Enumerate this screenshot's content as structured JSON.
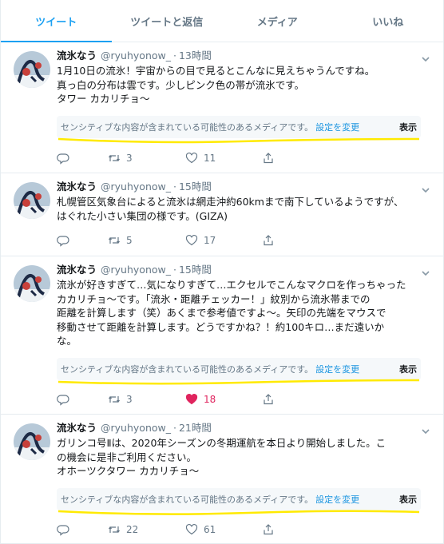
{
  "tabs": [
    {
      "label": "ツイート",
      "active": true
    },
    {
      "label": "ツイートと返信",
      "active": false
    },
    {
      "label": "メディア",
      "active": false
    },
    {
      "label": "いいね",
      "active": false
    }
  ],
  "sensitive_warning": {
    "text": "センシティブな内容が含まれている可能性のあるメディアです。",
    "link": "設定を変更",
    "show": "表示"
  },
  "colors": {
    "accent": "#1da1f2",
    "like": "#e0245e",
    "highlight": "#ffea00"
  },
  "tweets": [
    {
      "name": "流氷なう",
      "handle": "@ryuhyonow_",
      "separator": "·",
      "time": "13時間",
      "text": "1月10日の流氷！宇宙からの目で見るとこんなに見えちゃうんですね。\n真っ白の分布は雲です。少しピンク色の帯が流氷です。\nタワー カカリチョ〜",
      "sensitive_media": true,
      "replies": "",
      "retweets": "3",
      "likes": "11",
      "liked": false
    },
    {
      "name": "流氷なう",
      "handle": "@ryuhyonow_",
      "separator": "·",
      "time": "15時間",
      "text": "札幌管区気象台によると流氷は網走沖約60kmまで南下しているようですが、\nはぐれた小さい集団の様です。(GIZA)",
      "sensitive_media": false,
      "replies": "",
      "retweets": "5",
      "likes": "17",
      "liked": false
    },
    {
      "name": "流氷なう",
      "handle": "@ryuhyonow_",
      "separator": "·",
      "time": "15時間",
      "text": "流氷が好きすぎて…気になりすぎて…エクセルでこんなマクロを作っちゃった\nカカリチョ〜です。「流氷・距離チェッカー！」紋別から流氷帯までの\n距離を計算します（笑）あくまで参考値ですよ〜。矢印の先端をマウスで\n移動させて距離を計算します。どうですかね？！約100キロ…まだ遠いか\nな。",
      "sensitive_media": true,
      "replies": "",
      "retweets": "3",
      "likes": "18",
      "liked": true
    },
    {
      "name": "流氷なう",
      "handle": "@ryuhyonow_",
      "separator": "·",
      "time": "21時間",
      "text": "ガリンコ号Ⅱは、2020年シーズンの冬期運航を本日より開始しました。こ\nの機会に是非ご利用ください。\nオホーツクタワー カカリチョ〜",
      "sensitive_media": true,
      "replies": "",
      "retweets": "22",
      "likes": "61",
      "liked": false
    }
  ]
}
